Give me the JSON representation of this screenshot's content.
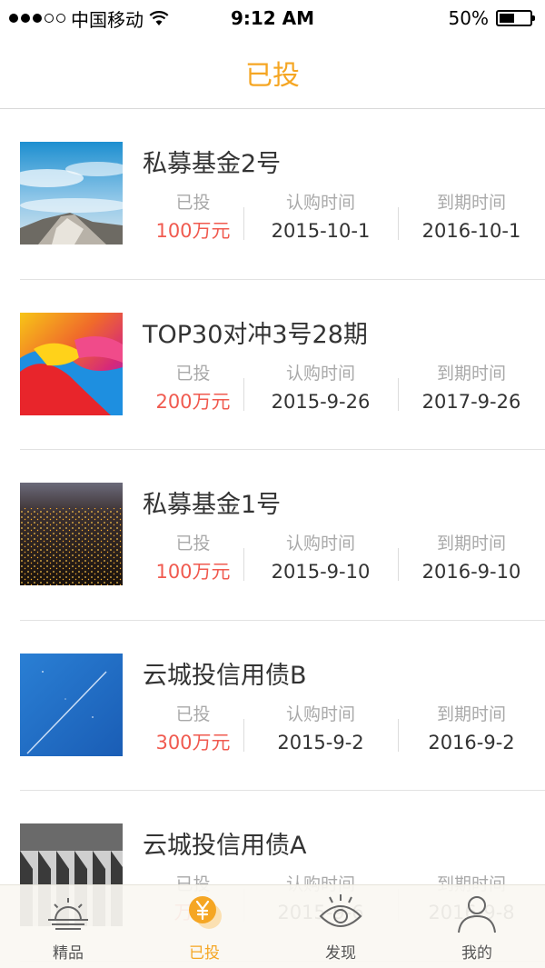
{
  "status_bar": {
    "carrier": "中国移动",
    "time": "9:12 AM",
    "battery": "50%",
    "battery_level": 0.5
  },
  "nav": {
    "title": "已投"
  },
  "columns": {
    "invested": "已投",
    "subscribe": "认购时间",
    "expiry": "到期时间"
  },
  "funds": [
    {
      "name": "私募基金2号",
      "amount": "100万元",
      "subscribe_date": "2015-10-1",
      "expiry_date": "2016-10-1",
      "thumbnail": "mountain-sky"
    },
    {
      "name": "TOP30对冲3号28期",
      "amount": "200万元",
      "subscribe_date": "2015-9-26",
      "expiry_date": "2017-9-26",
      "thumbnail": "colorful-abstract"
    },
    {
      "name": "私募基金1号",
      "amount": "100万元",
      "subscribe_date": "2015-9-10",
      "expiry_date": "2016-9-10",
      "thumbnail": "city-lights"
    },
    {
      "name": "云城投信用债B",
      "amount": "300万元",
      "subscribe_date": "2015-9-2",
      "expiry_date": "2016-9-2",
      "thumbnail": "blue-sky-jet"
    },
    {
      "name": "云城投信用债A",
      "amount": "万元",
      "subscribe_date": "2015-9-6",
      "expiry_date": "2016-9-8",
      "thumbnail": "piano-keys"
    }
  ],
  "tab_bar": {
    "tabs": [
      {
        "label": "精品",
        "icon": "sunrise-icon",
        "active": false
      },
      {
        "label": "已投",
        "icon": "yen-coin-icon",
        "active": true
      },
      {
        "label": "发现",
        "icon": "eye-icon",
        "active": false
      },
      {
        "label": "我的",
        "icon": "person-icon",
        "active": false
      }
    ]
  },
  "colors": {
    "accent": "#f5a623",
    "amount_red": "#f05a4f",
    "label_gray": "#a9a9a9"
  }
}
